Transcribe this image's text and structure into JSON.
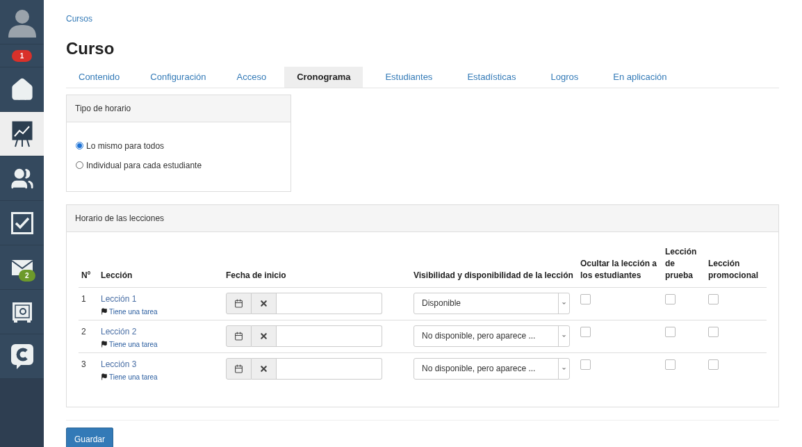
{
  "sidebar": {
    "items": [
      {
        "kind": "avatar",
        "selected": false
      },
      {
        "kind": "notifications",
        "selected": false,
        "badge": "1"
      },
      {
        "kind": "home",
        "selected": false
      },
      {
        "kind": "courses",
        "selected": true
      },
      {
        "kind": "users",
        "selected": false
      },
      {
        "kind": "tasks",
        "selected": false
      },
      {
        "kind": "messages",
        "selected": false,
        "badge": "2"
      },
      {
        "kind": "safe",
        "selected": false
      },
      {
        "kind": "chat",
        "selected": false
      }
    ]
  },
  "breadcrumb": "Cursos",
  "title": "Curso",
  "tabs": [
    {
      "label": "Contenido",
      "selected": false
    },
    {
      "label": "Configuración",
      "selected": false
    },
    {
      "label": "Acceso",
      "selected": false
    },
    {
      "label": "Cronograma",
      "selected": true
    },
    {
      "label": "Estudiantes",
      "selected": false
    },
    {
      "label": "Estadísticas",
      "selected": false
    },
    {
      "label": "Logros",
      "selected": false
    },
    {
      "label": "En aplicación",
      "selected": false
    }
  ],
  "schedule_type": {
    "title": "Tipo de horario",
    "options": [
      {
        "label": "Lo mismo para todos",
        "selected": true
      },
      {
        "label": "Individual para cada estudiante",
        "selected": false
      }
    ]
  },
  "lessons_schedule": {
    "title": "Horario de las lecciones",
    "columns": [
      "Nº",
      "Lección",
      "Fecha de inicio",
      "Visibilidad y disponibilidad de la lección",
      "Ocultar la lección a los estudiantes",
      "Lección de prueba",
      "Lección promocional"
    ],
    "rows": [
      {
        "number": "1",
        "lesson": "Lección 1",
        "note": "Tiene una tarea",
        "visibility": "Disponible",
        "hidden": false,
        "trial": false,
        "promo": false
      },
      {
        "number": "2",
        "lesson": "Lección 2",
        "note": "Tiene una tarea",
        "visibility": "No disponible, pero aparece ...",
        "hidden": false,
        "trial": false,
        "promo": false
      },
      {
        "number": "3",
        "lesson": "Lección 3",
        "note": "Tiene una tarea",
        "visibility": "No disponible, pero aparece ...",
        "hidden": false,
        "trial": false,
        "promo": false
      }
    ]
  },
  "save_button": "Guardar"
}
